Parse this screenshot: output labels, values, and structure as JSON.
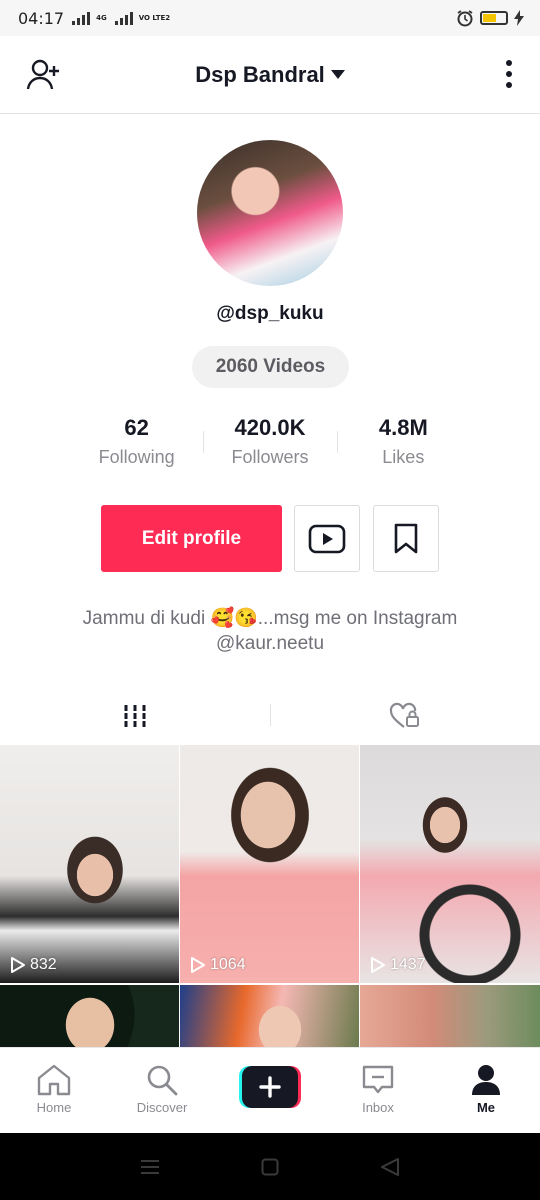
{
  "status_bar": {
    "time": "04:17",
    "network": "4G",
    "volte": "VO LTE2"
  },
  "header": {
    "username": "Dsp Bandral"
  },
  "profile": {
    "handle": "@dsp_kuku",
    "videos_label": "2060 Videos",
    "stats": [
      {
        "value": "62",
        "label": "Following"
      },
      {
        "value": "420.0K",
        "label": "Followers"
      },
      {
        "value": "4.8M",
        "label": "Likes"
      }
    ],
    "edit_label": "Edit profile",
    "bio_line1": "Jammu di kudi 🥰😘...msg me on Instagram",
    "bio_line2": "@kaur.neetu"
  },
  "videos": [
    {
      "views": "832"
    },
    {
      "views": "1064"
    },
    {
      "views": "1437"
    },
    {
      "views": ""
    },
    {
      "views": ""
    },
    {
      "views": ""
    }
  ],
  "bottom_nav": {
    "home": "Home",
    "discover": "Discover",
    "inbox": "Inbox",
    "me": "Me"
  },
  "colors": {
    "accent": "#fe2c55",
    "text": "#161823",
    "muted": "#8a8b91"
  }
}
